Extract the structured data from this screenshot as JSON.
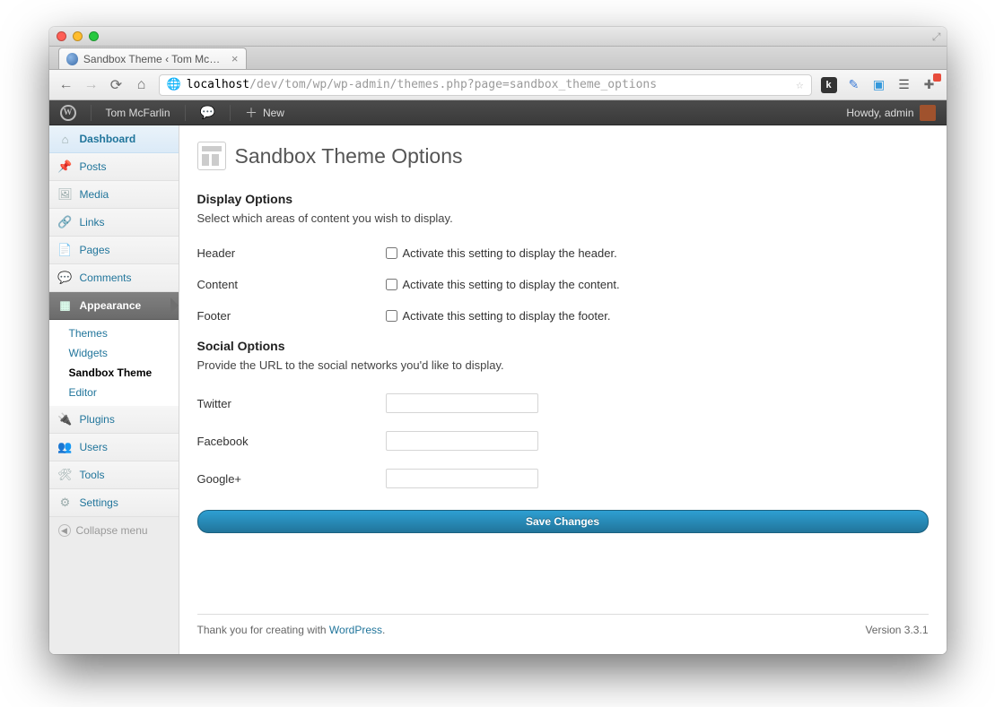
{
  "browser": {
    "tab_title": "Sandbox Theme ‹ Tom McFa…",
    "url_host": "localhost",
    "url_path": "/dev/tom/wp/wp-admin/themes.php?page=sandbox_theme_options"
  },
  "adminbar": {
    "site_name": "Tom McFarlin",
    "new_label": "New",
    "howdy": "Howdy, admin"
  },
  "sidebar": {
    "dashboard": "Dashboard",
    "posts": "Posts",
    "media": "Media",
    "links": "Links",
    "pages": "Pages",
    "comments": "Comments",
    "appearance": "Appearance",
    "plugins": "Plugins",
    "users": "Users",
    "tools": "Tools",
    "settings": "Settings",
    "collapse": "Collapse menu",
    "submenu": {
      "themes": "Themes",
      "widgets": "Widgets",
      "sandbox": "Sandbox Theme",
      "editor": "Editor"
    }
  },
  "page": {
    "title": "Sandbox Theme Options",
    "display": {
      "heading": "Display Options",
      "desc": "Select which areas of content you wish to display.",
      "rows": {
        "header": {
          "label": "Header",
          "cb": "Activate this setting to display the header."
        },
        "content": {
          "label": "Content",
          "cb": "Activate this setting to display the content."
        },
        "footer": {
          "label": "Footer",
          "cb": "Activate this setting to display the footer."
        }
      }
    },
    "social": {
      "heading": "Social Options",
      "desc": "Provide the URL to the social networks you'd like to display.",
      "rows": {
        "twitter": {
          "label": "Twitter",
          "value": ""
        },
        "facebook": {
          "label": "Facebook",
          "value": ""
        },
        "google": {
          "label": "Google+",
          "value": ""
        }
      }
    },
    "save": "Save Changes"
  },
  "footer": {
    "thanks_pre": "Thank you for creating with ",
    "wp": "WordPress",
    "thanks_post": ".",
    "version": "Version 3.3.1"
  }
}
